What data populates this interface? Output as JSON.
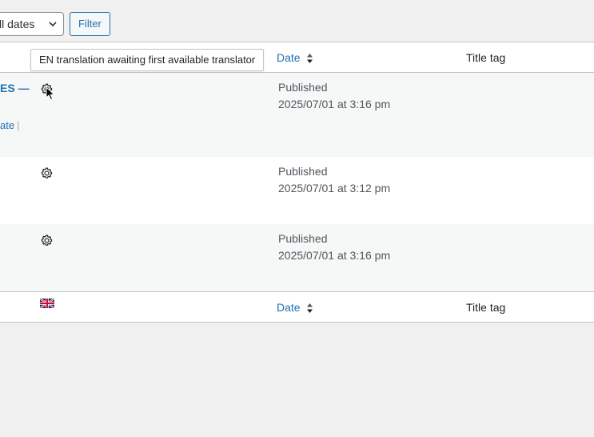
{
  "toolbar": {
    "date_filter_value": "ll dates",
    "filter_label": "Filter"
  },
  "table": {
    "header": {
      "date_label": "Date",
      "title_tag_label": "Title tag"
    },
    "rows": [
      {
        "title_fragment": "ES —",
        "action_fragment": "ate",
        "action_separator": "|",
        "status": "Published",
        "date": "2025/07/01 at 3:16 pm",
        "translation_icon": "gear-icon"
      },
      {
        "status": "Published",
        "date": "2025/07/01 at 3:12 pm",
        "translation_icon": "gear-icon"
      },
      {
        "status": "Published",
        "date": "2025/07/01 at 3:16 pm",
        "translation_icon": "gear-icon"
      }
    ],
    "footer": {
      "date_label": "Date",
      "title_tag_label": "Title tag",
      "language_icon": "uk-flag-icon"
    }
  },
  "tooltip": {
    "text": "EN translation awaiting first available translator"
  },
  "colors": {
    "link": "#2271b1",
    "border": "#c3c4c7",
    "background": "#f0f0f1",
    "alt_row": "#f6f7f7"
  }
}
